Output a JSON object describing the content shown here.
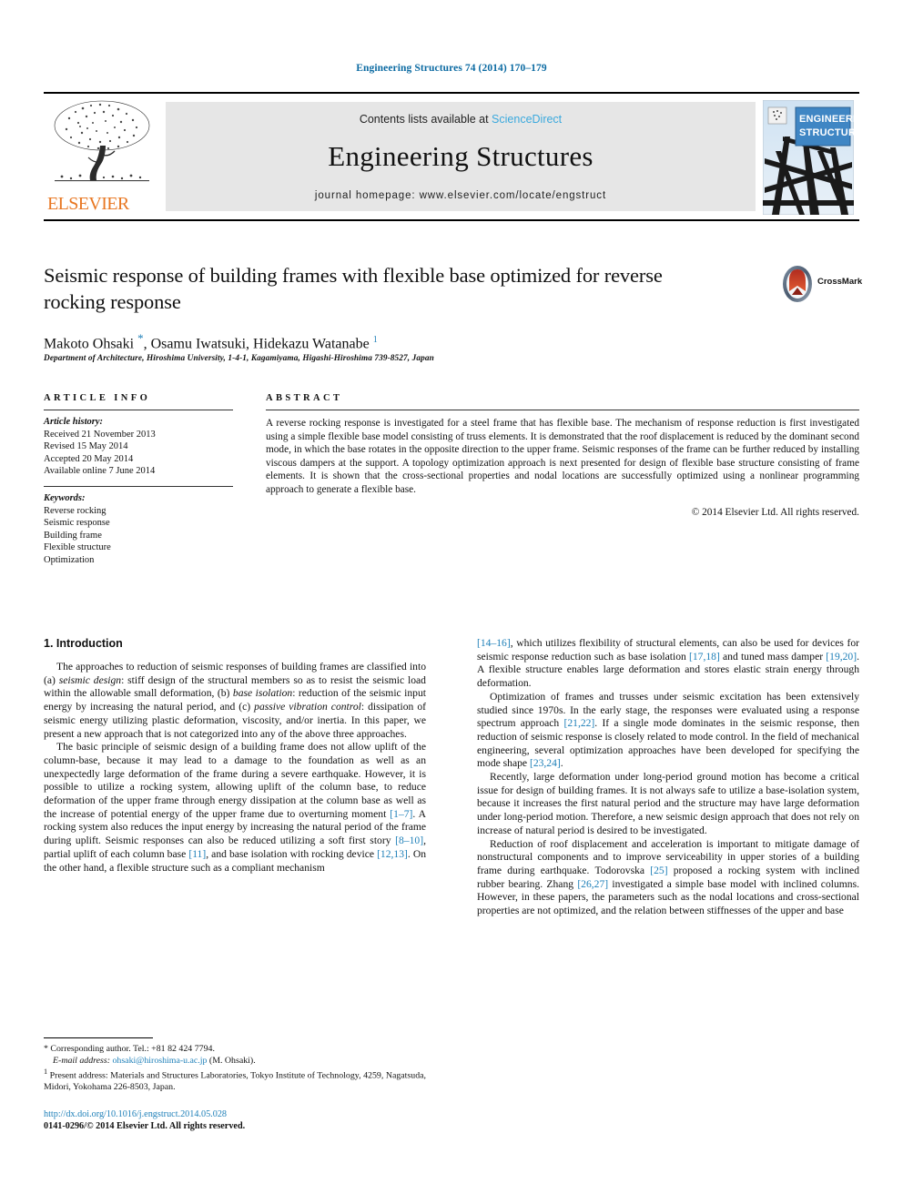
{
  "running_head": "Engineering Structures 74 (2014) 170–179",
  "masthead": {
    "contents_prefix": "Contents lists available at ",
    "sciencedirect": "ScienceDirect",
    "journal_title": "Engineering Structures",
    "homepage": "journal homepage: www.elsevier.com/locate/engstruct",
    "publisher_name": "ELSEVIER",
    "cover_line1": "ENGINEERING",
    "cover_line2": "STRUCTURES",
    "sciencedirect_color": "#3ba9dd",
    "elsevier_orange": "#e87722",
    "cover_blue": "#3f86c4"
  },
  "article": {
    "title": "Seismic response of building frames with flexible base optimized for reverse rocking response",
    "authors_html": "Makoto Ohsaki <span class=\"star\">*</span>, Osamu Iwatsuki, Hidekazu Watanabe <sup>1</sup>",
    "affiliation": "Department of Architecture, Hiroshima University, 1-4-1, Kagamiyama, Higashi-Hiroshima 739-8527, Japan",
    "crossmark_label": "CrossMark"
  },
  "info": {
    "heading": "ARTICLE INFO",
    "history_label": "Article history:",
    "history": [
      "Received 21 November 2013",
      "Revised 15 May 2014",
      "Accepted 20 May 2014",
      "Available online 7 June 2014"
    ],
    "keywords_label": "Keywords:",
    "keywords": [
      "Reverse rocking",
      "Seismic response",
      "Building frame",
      "Flexible structure",
      "Optimization"
    ]
  },
  "abstract": {
    "heading": "ABSTRACT",
    "text": "A reverse rocking response is investigated for a steel frame that has flexible base. The mechanism of response reduction is first investigated using a simple flexible base model consisting of truss elements. It is demonstrated that the roof displacement is reduced by the dominant second mode, in which the base rotates in the opposite direction to the upper frame. Seismic responses of the frame can be further reduced by installing viscous dampers at the support. A topology optimization approach is next presented for design of flexible base structure consisting of frame elements. It is shown that the cross-sectional properties and nodal locations are successfully optimized using a nonlinear programming approach to generate a flexible base.",
    "copyright": "© 2014 Elsevier Ltd. All rights reserved."
  },
  "body": {
    "section_heading": "1. Introduction",
    "left_paragraphs": [
      "The approaches to reduction of seismic responses of building frames are classified into (a) <i>seismic design</i>: stiff design of the structural members so as to resist the seismic load within the allowable small deformation, (b) <i>base isolation</i>: reduction of the seismic input energy by increasing the natural period, and (c) <i>passive vibration control</i>: dissipation of seismic energy utilizing plastic deformation, viscosity, and/or inertia. In this paper, we present a new approach that is not categorized into any of the above three approaches.",
      "The basic principle of seismic design of a building frame does not allow uplift of the column-base, because it may lead to a damage to the foundation as well as an unexpectedly large deformation of the frame during a severe earthquake. However, it is possible to utilize a rocking system, allowing uplift of the column base, to reduce deformation of the upper frame through energy dissipation at the column base as well as the increase of potential energy of the upper frame due to overturning moment <span class=\"ref\">[1–7]</span>. A rocking system also reduces the input energy by increasing the natural period of the frame during uplift. Seismic responses can also be reduced utilizing a soft first story <span class=\"ref\">[8–10]</span>, partial uplift of each column base <span class=\"ref\">[11]</span>, and base isolation with rocking device <span class=\"ref\">[12,13]</span>. On the other hand, a flexible structure such as a compliant mechanism"
    ],
    "right_paragraphs": [
      "<span class=\"ref\">[14–16]</span>, which utilizes flexibility of structural elements, can also be used for devices for seismic response reduction such as base isolation <span class=\"ref\">[17,18]</span> and tuned mass damper <span class=\"ref\">[19,20]</span>. A flexible structure enables large deformation and stores elastic strain energy through deformation.",
      "Optimization of frames and trusses under seismic excitation has been extensively studied since 1970s. In the early stage, the responses were evaluated using a response spectrum approach <span class=\"ref\">[21,22]</span>. If a single mode dominates in the seismic response, then reduction of seismic response is closely related to mode control. In the field of mechanical engineering, several optimization approaches have been developed for specifying the mode shape <span class=\"ref\">[23,24]</span>.",
      "Recently, large deformation under long-period ground motion has become a critical issue for design of building frames. It is not always safe to utilize a base-isolation system, because it increases the first natural period and the structure may have large deformation under long-period motion. Therefore, a new seismic design approach that does not rely on increase of natural period is desired to be investigated.",
      "Reduction of roof displacement and acceleration is important to mitigate damage of nonstructural components and to improve serviceability in upper stories of a building frame during earthquake. Todorovska <span class=\"ref\">[25]</span> proposed a rocking system with inclined rubber bearing. Zhang <span class=\"ref\">[26,27]</span> investigated a simple base model with inclined columns. However, in these papers, the parameters such as the nodal locations and cross-sectional properties are not optimized, and the relation between stiffnesses of the upper and base"
    ]
  },
  "footnotes": {
    "corresponding": "* Corresponding author. Tel.: +81 82 424 7794.",
    "email_label": "E-mail address:",
    "email": "ohsaki@hiroshima-u.ac.jp",
    "email_suffix": " (M. Ohsaki).",
    "present_address": "<sup>1</sup> Present address: Materials and Structures Laboratories, Tokyo Institute of Technology, 4259, Nagatsuda, Midori, Yokohama 226-8503, Japan."
  },
  "doi": {
    "url": "http://dx.doi.org/10.1016/j.engstruct.2014.05.028",
    "issn": "0141-0296/© 2014 Elsevier Ltd. All rights reserved."
  }
}
